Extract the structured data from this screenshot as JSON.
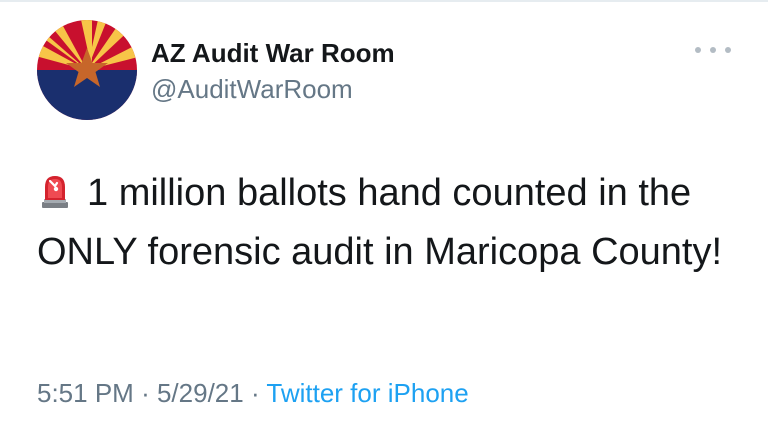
{
  "tweet": {
    "author": {
      "display_name": "AZ Audit War Room",
      "handle": "@AuditWarRoom",
      "avatar_icon": "arizona-flag-avatar"
    },
    "more_icon": "more-horizontal-icon",
    "body": {
      "emoji_icon": "rotating-light-siren-icon",
      "text": "1 million ballots hand counted in the ONLY forensic audit in Maricopa County!"
    },
    "meta": {
      "time": "5:51 PM",
      "separator": "·",
      "date": "5/29/21",
      "source": "Twitter for iPhone"
    }
  },
  "colors": {
    "text_primary": "#14171a",
    "text_secondary": "#657786",
    "link": "#1da1f2",
    "flag_red": "#c8102e",
    "flag_yellow": "#f7c548",
    "flag_blue": "#1a2f6e",
    "flag_star": "#c7662a"
  }
}
